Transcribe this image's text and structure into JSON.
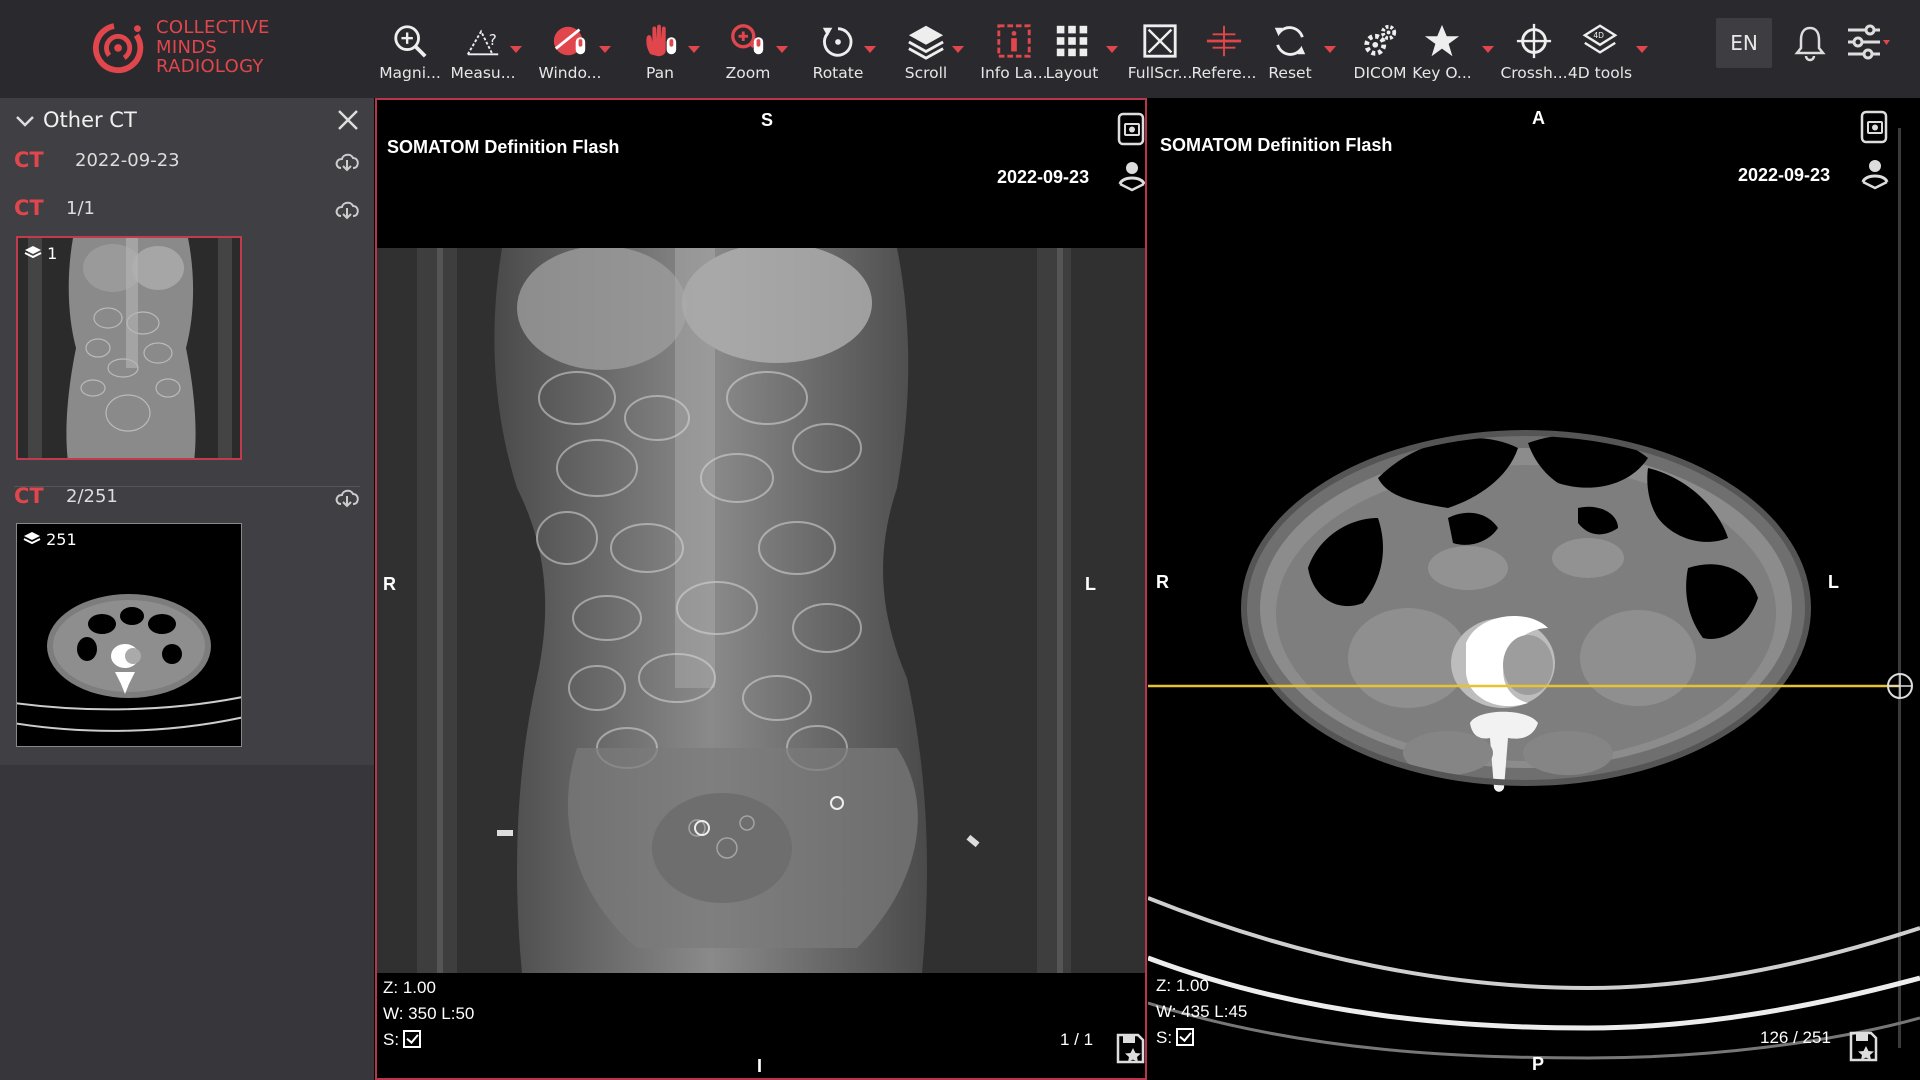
{
  "app": {
    "brand_lines": [
      "COLLECTIVE",
      "MINDS",
      "RADIOLOGY"
    ],
    "accent_color": "#e0464b",
    "language": "EN"
  },
  "toolbar": {
    "tools": [
      {
        "label": "Magni...",
        "icon": "magnifier-icon"
      },
      {
        "label": "Measu...",
        "icon": "measure-icon"
      },
      {
        "label": "Windo...",
        "icon": "window-level-icon"
      },
      {
        "label": "Pan",
        "icon": "pan-hand-icon"
      },
      {
        "label": "Zoom",
        "icon": "zoom-icon"
      },
      {
        "label": "Rotate",
        "icon": "rotate-icon"
      },
      {
        "label": "Scroll",
        "icon": "scroll-layers-icon"
      },
      {
        "label": "Info La...",
        "icon": "info-layer-icon"
      },
      {
        "label": "Layout",
        "icon": "layout-grid-icon"
      },
      {
        "label": "FullScr...",
        "icon": "fullscreen-icon"
      },
      {
        "label": "Refere...",
        "icon": "reference-lines-icon"
      },
      {
        "label": "Reset",
        "icon": "reset-icon"
      },
      {
        "label": "DICOM",
        "icon": "dicom-gears-icon"
      },
      {
        "label": "Key O...",
        "icon": "key-object-star-icon"
      },
      {
        "label": "Crossh...",
        "icon": "crosshair-icon"
      },
      {
        "label": "4D tools",
        "icon": "4d-tools-icon"
      }
    ]
  },
  "sidebar": {
    "title": "Other CT",
    "study": {
      "modality": "CT",
      "date": "2022-09-23"
    },
    "series": [
      {
        "modality": "CT",
        "label": "1/1",
        "count": "1"
      },
      {
        "modality": "CT",
        "label": "2/251",
        "count": "251"
      }
    ]
  },
  "viewports": [
    {
      "device": "SOMATOM Definition Flash",
      "date": "2022-09-23",
      "orient_top": "S",
      "orient_bottom": "I",
      "orient_left": "R",
      "orient_right": "L",
      "zoom": "Z: 1.00",
      "window": "W: 350 L:50",
      "sync_label": "S:",
      "frame": "1 / 1"
    },
    {
      "device": "SOMATOM Definition Flash",
      "date": "2022-09-23",
      "orient_top": "A",
      "orient_bottom": "P",
      "orient_left": "R",
      "orient_right": "L",
      "zoom": "Z: 1.00",
      "window": "W: 435 L:45",
      "sync_label": "S:",
      "frame": "126 / 251"
    }
  ]
}
